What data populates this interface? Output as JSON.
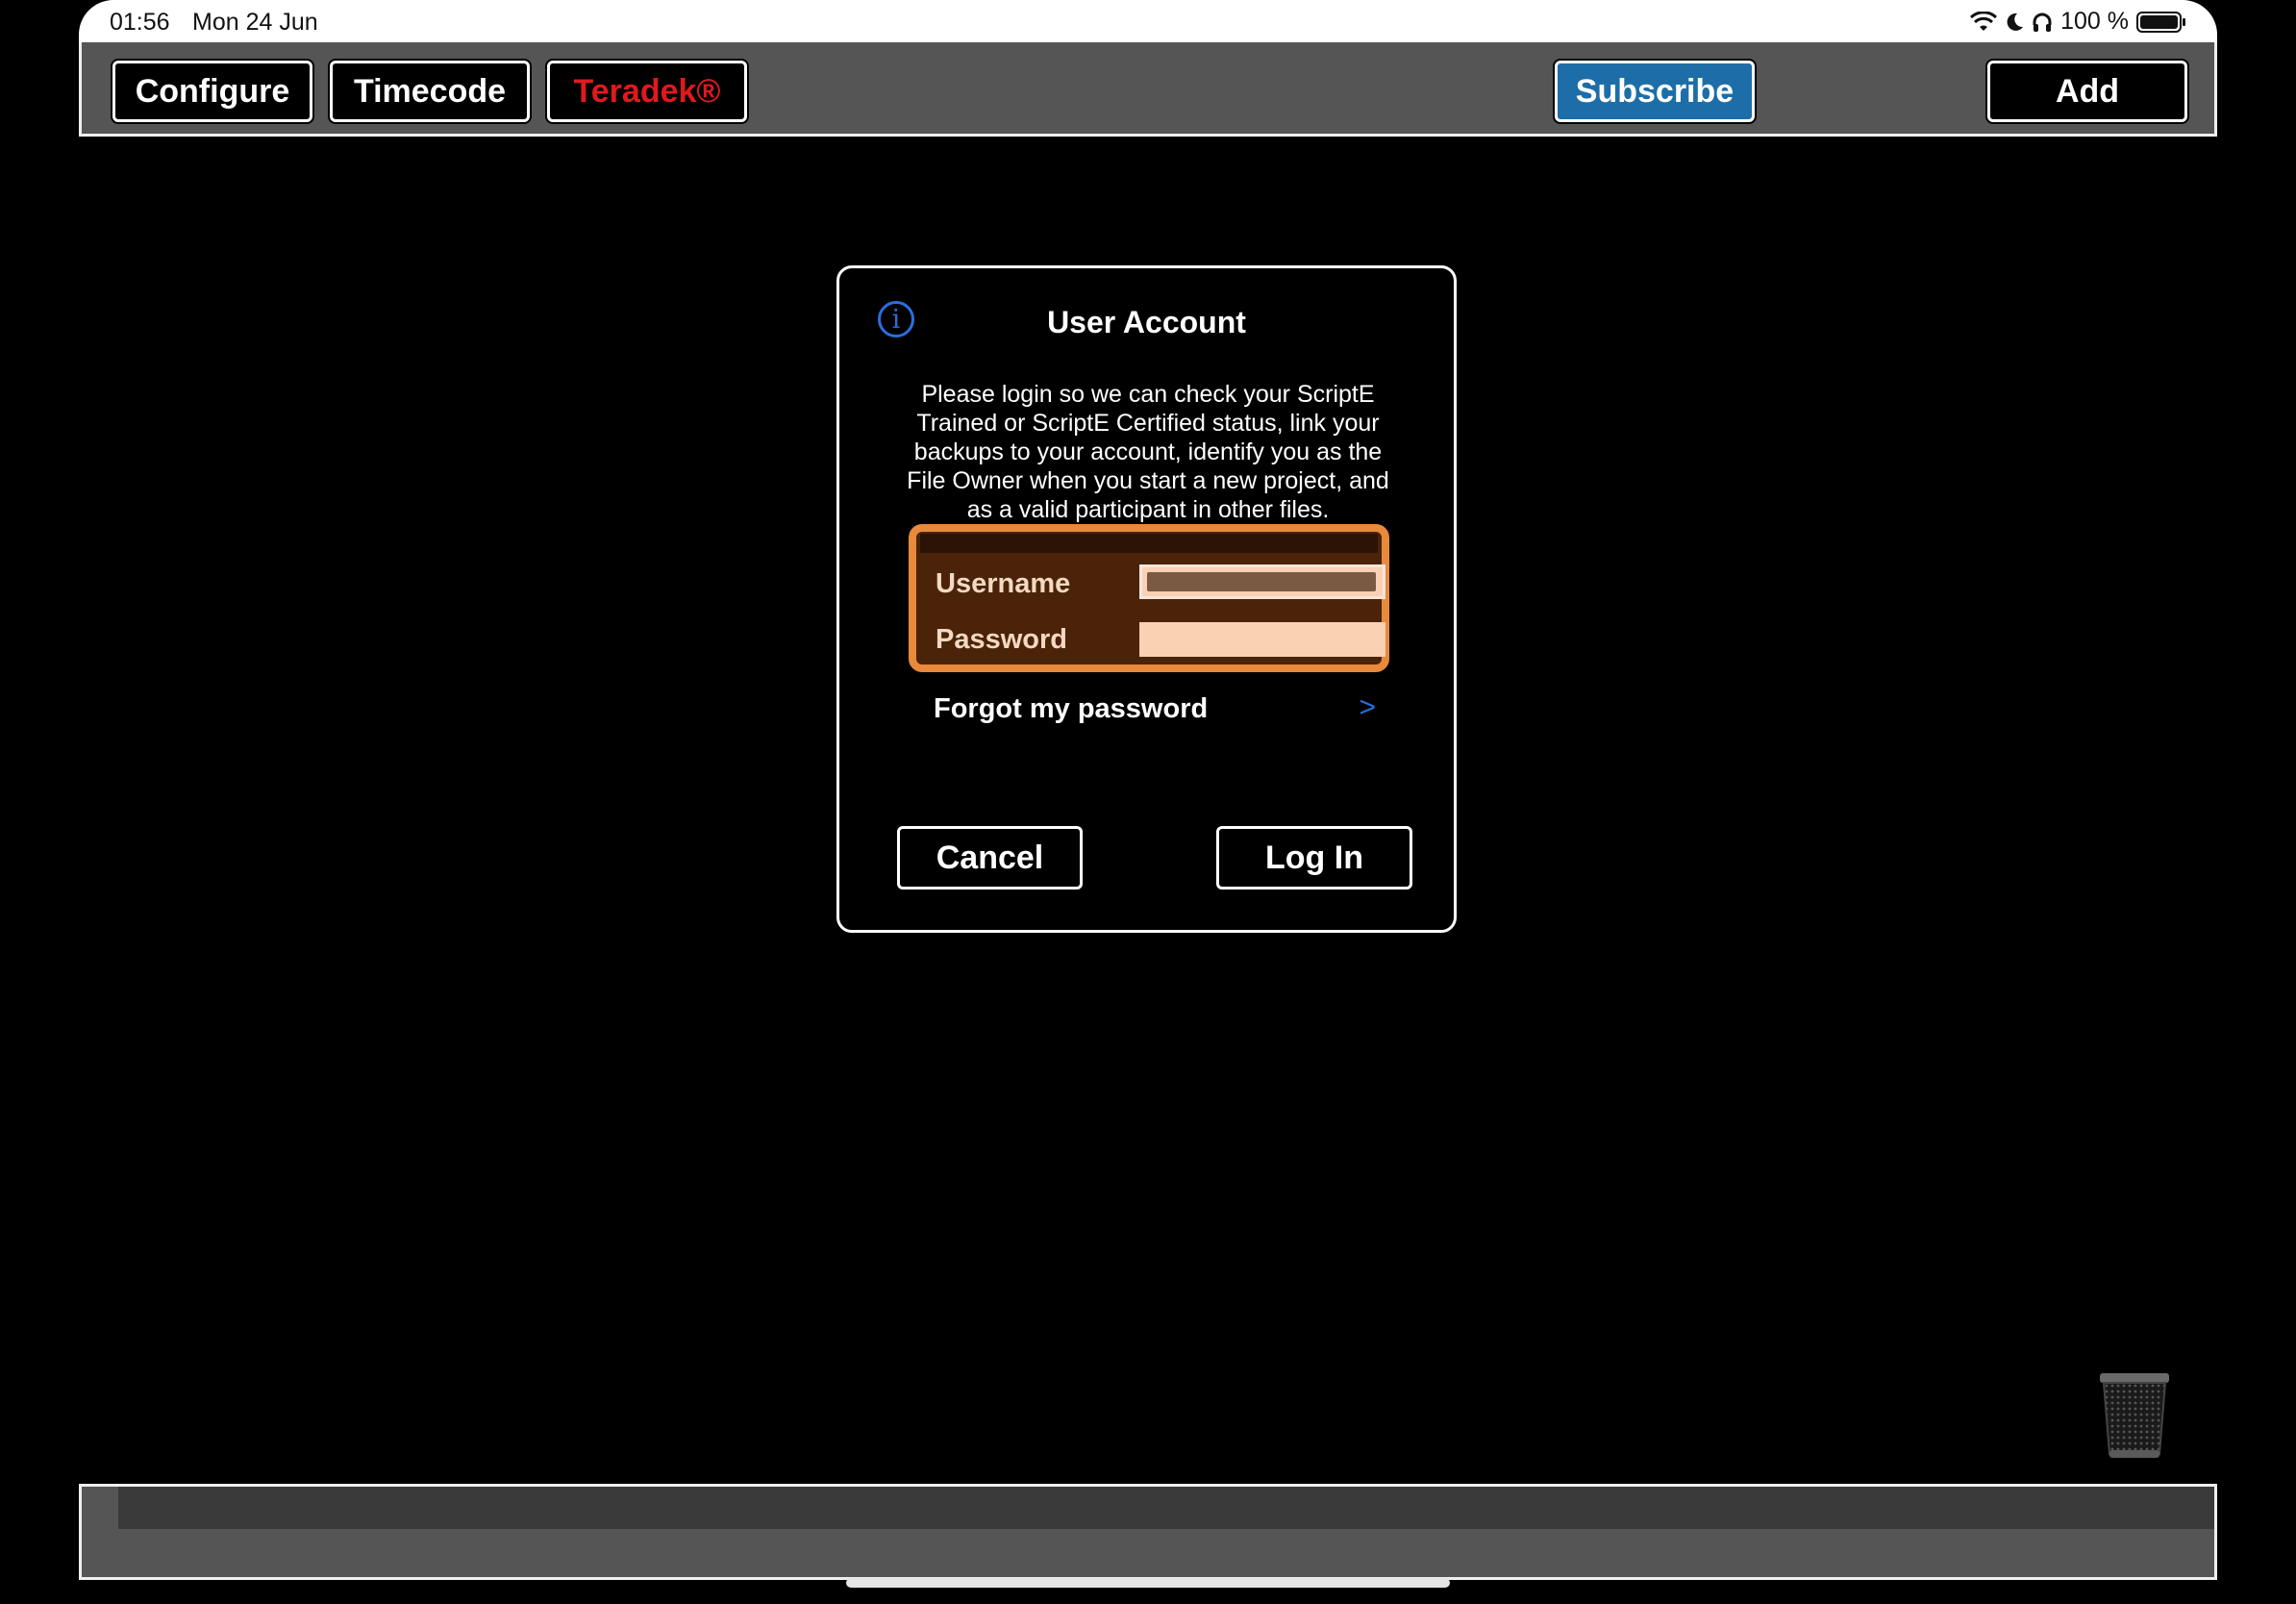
{
  "status_bar": {
    "time": "01:56",
    "date": "Mon 24 Jun",
    "battery": "100 %",
    "icons": [
      "wifi-icon",
      "moon-icon",
      "headphones-icon",
      "battery-icon"
    ]
  },
  "toolbar": {
    "configure_label": "Configure",
    "timecode_label": "Timecode",
    "teradek_label": "Teradek®",
    "subscribe_label": "Subscribe",
    "add_label": "Add"
  },
  "dialog": {
    "title": "User Account",
    "message": "Please login so we can check your ScriptE Trained or ScriptE Certified status, link your backups to your account, identify you as the File Owner when you start a new project, and as a valid participant in other files.",
    "username_label": "Username",
    "password_label": "Password",
    "username_value": "",
    "password_value": "",
    "forgot_label": "Forgot my password",
    "forgot_chevron": ">",
    "cancel_label": "Cancel",
    "login_label": "Log In"
  },
  "colors": {
    "toolbar_bg": "#555555",
    "subscribe_bg": "#1d6ea8",
    "teradek_text": "#e0191e",
    "login_box_border": "#e8893b",
    "login_box_bg": "#4a2309",
    "field_bg": "#fbd1b4",
    "link_blue": "#2a6fe0"
  }
}
